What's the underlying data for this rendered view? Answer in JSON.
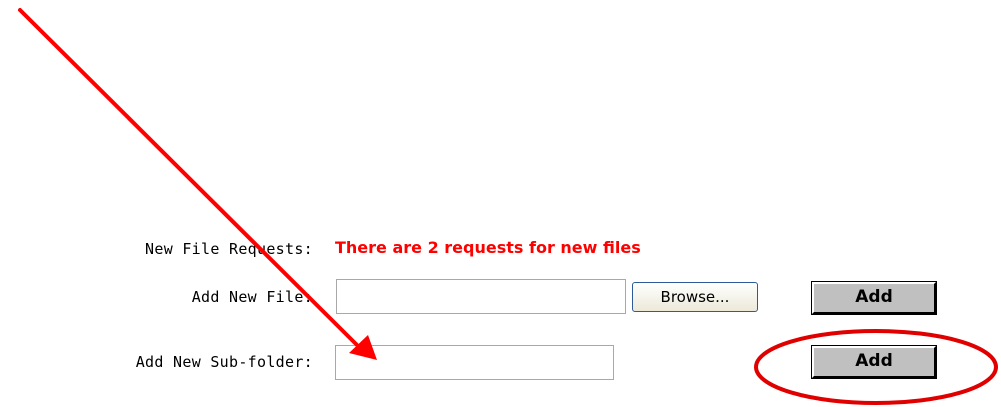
{
  "form": {
    "new_file_requests_label": "New File Requests:",
    "new_file_requests_status": "There are 2 requests for new files",
    "add_new_file_label": "Add New File:",
    "add_new_file_value": "",
    "browse_button_label": "Browse...",
    "add_file_button_label": "Add",
    "add_new_subfolder_label": "Add New Sub-folder:",
    "add_new_subfolder_value": "",
    "add_subfolder_button_label": "Add"
  },
  "annotation": {
    "arrow_color": "#ff0000",
    "circle_color": "#e00000"
  },
  "colors": {
    "status_text": "#ff0000",
    "button_face": "#c0c0c0"
  }
}
